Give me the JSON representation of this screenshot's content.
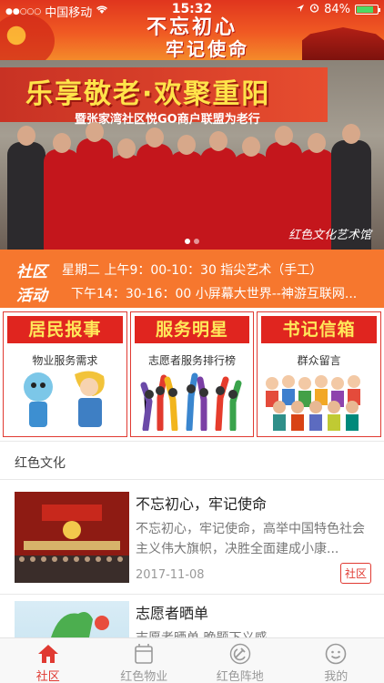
{
  "status_bar": {
    "signal": "●●○○○",
    "carrier": "中国移动",
    "time": "15:32",
    "battery": "84%",
    "battery_level": 0.84
  },
  "header": {
    "slogan_line1": "不忘初心",
    "slogan_line2": "牢记使命"
  },
  "banner": {
    "title": "乐享敬老·欢聚重阳",
    "subtitle": "暨张家湾社区悦GO商户联盟为老行",
    "caption": "红色文化艺术馆",
    "slide_count": 2,
    "active_slide": 0
  },
  "activity": {
    "label_line1": "社区",
    "label_line2": "活动",
    "items": [
      "星期二 上午9：00-10：30 指尖艺术（手工）",
      "下午14：30-16：00 小屏幕大世界--神游互联网..."
    ]
  },
  "services": [
    {
      "title": "居民报事",
      "subtitle": "物业服务需求"
    },
    {
      "title": "服务明星",
      "subtitle": "志愿者服务排行榜"
    },
    {
      "title": "书记信箱",
      "subtitle": "群众留言"
    }
  ],
  "section": {
    "title": "红色文化"
  },
  "news": [
    {
      "headline": "不忘初心，牢记使命",
      "summary": "不忘初心，牢记使命，高举中国特色社会主义伟大旗帜，决胜全面建成小康...",
      "date": "2017-11-08",
      "tag": "社区"
    },
    {
      "headline": "志愿者晒单",
      "summary": "志愿者晒单 晚题下义感"
    }
  ],
  "tabbar": {
    "tabs": [
      {
        "label": "社区",
        "icon": "home-icon",
        "active": true
      },
      {
        "label": "红色物业",
        "icon": "building-icon",
        "active": false
      },
      {
        "label": "红色阵地",
        "icon": "hammer-sickle-icon",
        "active": false
      },
      {
        "label": "我的",
        "icon": "smiley-icon",
        "active": false
      }
    ]
  },
  "colors": {
    "accent_red": "#e03a32",
    "activity_orange": "#f6772e",
    "tile_title_yellow": "#ffe85a"
  }
}
